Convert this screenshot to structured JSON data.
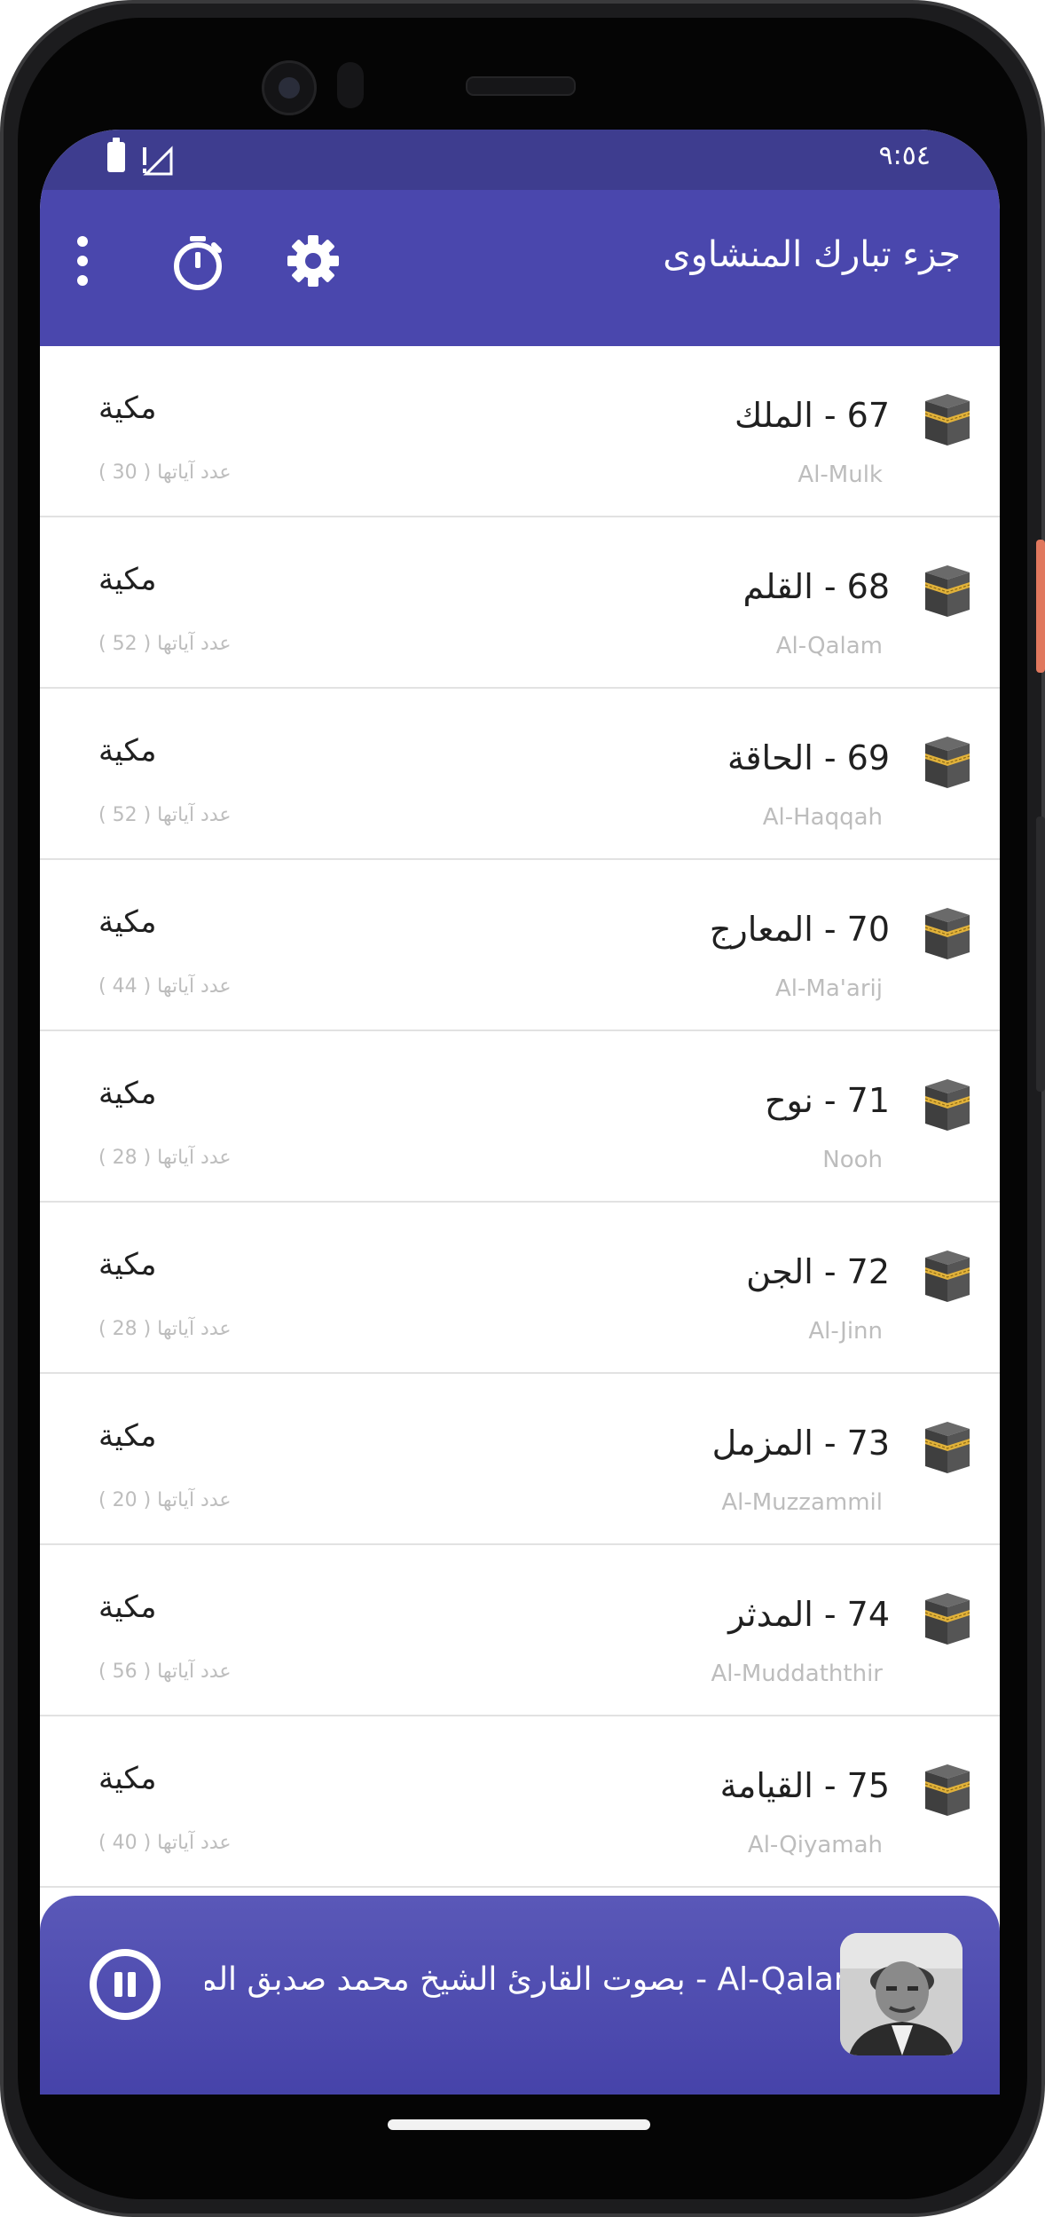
{
  "status_bar": {
    "time": "٩:٥٤"
  },
  "app_bar": {
    "title": "جزء تبارك المنشاوى"
  },
  "surahs": [
    {
      "name": "67 - الملك",
      "latin": "Al-Mulk",
      "type": "مكية",
      "verses": "عدد آياتها ( 30 )"
    },
    {
      "name": "68 - القلم",
      "latin": "Al-Qalam",
      "type": "مكية",
      "verses": "عدد آياتها ( 52 )"
    },
    {
      "name": "69 - الحاقة",
      "latin": "Al-Haqqah",
      "type": "مكية",
      "verses": "عدد آياتها ( 52 )"
    },
    {
      "name": "70 - المعارج",
      "latin": "Al-Ma'arij",
      "type": "مكية",
      "verses": "عدد آياتها ( 44 )"
    },
    {
      "name": "71 - نوح",
      "latin": "Nooh",
      "type": "مكية",
      "verses": "عدد آياتها ( 28 )"
    },
    {
      "name": "72 - الجن",
      "latin": "Al-Jinn",
      "type": "مكية",
      "verses": "عدد آياتها ( 28 )"
    },
    {
      "name": "73 - المزمل",
      "latin": "Al-Muzzammil",
      "type": "مكية",
      "verses": "عدد آياتها ( 20 )"
    },
    {
      "name": "74 - المدثر",
      "latin": "Al-Muddaththir",
      "type": "مكية",
      "verses": "عدد آياتها ( 56 )"
    },
    {
      "name": "75 - القيامة",
      "latin": "Al-Qiyamah",
      "type": "مكية",
      "verses": "عدد آياتها ( 40 )"
    }
  ],
  "player": {
    "now_playing": "Al-Qalam - بصوت القارئ الشيخ محمد صدبق المنشاوى",
    "state": "playing"
  },
  "colors": {
    "primary": "#4a47ad",
    "status_bar": "#3e3d8f",
    "divider": "#e2e2e2"
  }
}
